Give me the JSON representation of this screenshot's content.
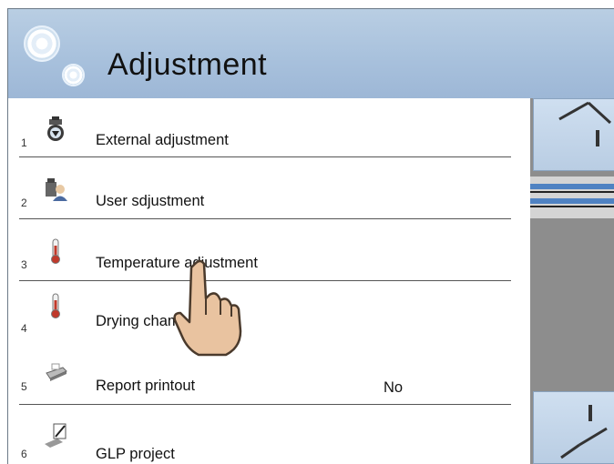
{
  "header": {
    "title": "Adjustment"
  },
  "menu": {
    "items": [
      {
        "number": "1",
        "label": "External adjustment",
        "value": "",
        "icon": "weight-icon"
      },
      {
        "number": "2",
        "label": "User sdjustment",
        "value": "",
        "icon": "user-weight-icon"
      },
      {
        "number": "3",
        "label": "Temperature adjustment",
        "value": "",
        "icon": "thermometer-icon"
      },
      {
        "number": "4",
        "label": "Drying chamber test",
        "value": "",
        "icon": "thermometer-icon"
      },
      {
        "number": "5",
        "label": "Report printout",
        "value": "No",
        "icon": "printer-icon"
      },
      {
        "number": "6",
        "label": "GLP project",
        "value": "",
        "icon": "document-pen-icon"
      }
    ]
  },
  "colors": {
    "header": "#a9c2dd",
    "scroll_thumb": "#4f82c2",
    "scrollbar": "#8d8d8d"
  }
}
